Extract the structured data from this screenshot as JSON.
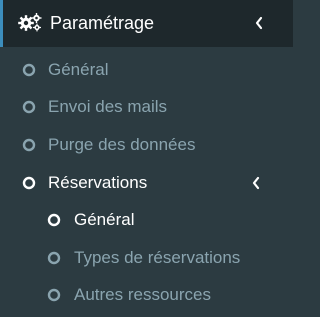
{
  "menu": {
    "title": "Paramétrage",
    "title_icon": "gears-icon",
    "items": [
      {
        "label": "Général",
        "active": false
      },
      {
        "label": "Envoi des mails",
        "active": false
      },
      {
        "label": "Purge des données",
        "active": false
      },
      {
        "label": "Réservations",
        "active": true
      }
    ],
    "subitems": [
      {
        "label": "Général",
        "active": true
      },
      {
        "label": "Types de réservations",
        "active": false
      },
      {
        "label": "Autres ressources",
        "active": false
      }
    ]
  },
  "colors": {
    "header_bg": "#1e282c",
    "accent": "#3c8dbc",
    "menu_bg": "#2c3b41",
    "muted_text": "#8aa4af",
    "active_text": "#ffffff"
  }
}
